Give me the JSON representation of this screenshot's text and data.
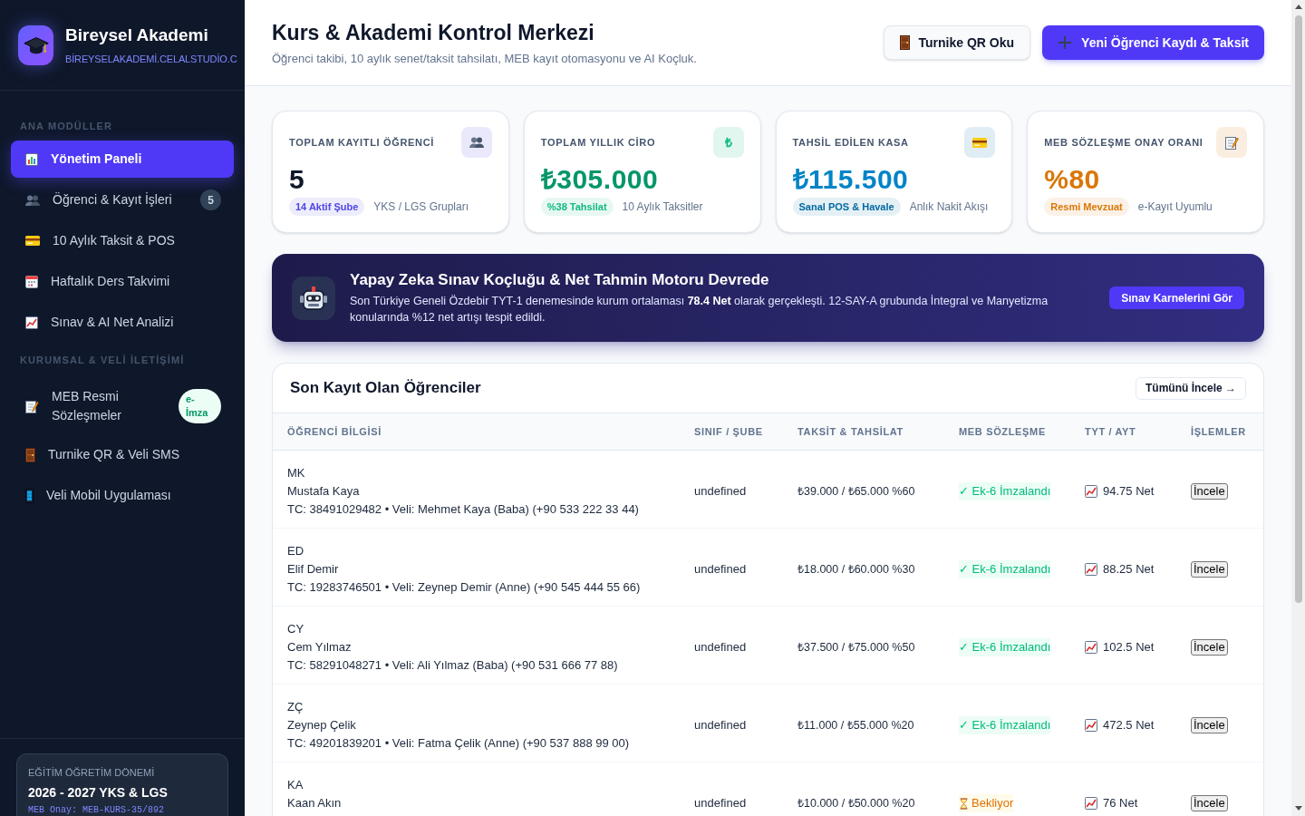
{
  "sidebar": {
    "brand": {
      "name": "Bireysel Akademi",
      "domain": "BİREYSELAKADEMİ.CELALSTUDİO.C"
    },
    "sections": [
      {
        "title": "ANA MODÜLLER",
        "items": [
          {
            "label": "Yönetim Paneli",
            "selected": true
          },
          {
            "label": "Öğrenci & Kayıt İşleri",
            "selected": false,
            "badge": {
              "kind": "count",
              "text": "5"
            }
          },
          {
            "label": "10 Aylık Taksit & POS",
            "selected": false
          },
          {
            "label": "Haftalık Ders Takvimi",
            "selected": false
          },
          {
            "label": "Sınav & AI Net Analizi",
            "selected": false
          }
        ]
      },
      {
        "title": "KURUMSAL & VELİ İLETİŞİMİ",
        "items": [
          {
            "label": "MEB Resmi Sözleşmeler",
            "selected": false,
            "badge": {
              "kind": "tag",
              "text": "e-İmza"
            }
          },
          {
            "label": "Turnike QR & Veli SMS",
            "selected": false
          },
          {
            "label": "Veli Mobil Uygulaması",
            "selected": false
          }
        ]
      }
    ],
    "term_card": {
      "label": "EĞİTİM ÖĞRETİM DÖNEMİ",
      "value": "2026 - 2027 YKS & LGS",
      "code": "MEB Onay: MEB-KURS-35/892"
    }
  },
  "header": {
    "title": "Kurs & Akademi Kontrol Merkezi",
    "subtitle": "Öğrenci takibi, 10 aylık senet/taksit tahsilatı, MEB kayıt otomasyonu ve AI Koçluk.",
    "buttons": [
      {
        "label": "Turnike QR Oku",
        "kind": "secondary"
      },
      {
        "label": "Yeni Öğrenci Kaydı & Taksit",
        "kind": "primary"
      }
    ]
  },
  "stats": [
    {
      "label": "TOPLAM KAYITLI ÖĞRENCİ",
      "value": "5",
      "color": "#0f172a",
      "badge": {
        "text": "14 Aktif Şube",
        "color": "#4f46e5"
      },
      "note": "YKS / LGS Grupları"
    },
    {
      "label": "TOPLAM YILLIK CİRO",
      "icon_glyph": "₺",
      "value": "₺305.000",
      "color": "#059669",
      "badge": {
        "text": "%38 Tahsilat",
        "color": "#10b981"
      },
      "note": "10 Aylık Taksitler"
    },
    {
      "label": "TAHSİL EDİLEN KASA",
      "value": "₺115.500",
      "color": "#0284c7",
      "badge": {
        "text": "Sanal POS & Havale",
        "color": "#0369a1"
      },
      "note": "Anlık Nakit Akışı"
    },
    {
      "label": "MEB SÖZLEŞME ONAY ORANI",
      "value": "%80",
      "color": "#d97706",
      "badge": {
        "text": "Resmi Mevzuat",
        "color": "#d97706"
      },
      "note": "e-Kayıt Uyumlu"
    }
  ],
  "banner": {
    "title": "Yapay Zeka Sınav Koçluğu & Net Tahmin Motoru Devrede",
    "text": "Son Türkiye Geneli Özdebir TYT-1 denemesinde kurum ortalaması **78.4 Net** olarak gerçekleşti. 12-SAY-A grubunda İntegral ve Manyetizma konularında %12 net artışı tespit edildi.",
    "button": "Sınav Karnelerini Gör"
  },
  "students_table": {
    "title": "Son Kayıt Olan Öğrenciler",
    "view_all": "Tümünü İncele →",
    "columns": [
      "ÖĞRENCİ BİLGİSİ",
      "SINIF / ŞUBE",
      "TAKSİT & TAHSİLAT",
      "MEB SÖZLEŞME",
      "TYT / AYT",
      "İŞLEMLER"
    ],
    "rows": [
      {
        "initials": "MK",
        "name": "Mustafa Kaya",
        "details": "TC: 38491029482 • Veli: Mehmet Kaya (Baba) (+90 533 222 33 44)",
        "group": "undefined",
        "payment": "₺39.000 / ₺65.000 %60",
        "contract": {
          "kind": "signed",
          "label": "✓ Ek-6 İmzalandı"
        },
        "score": "94.75 Net",
        "action": "İncele"
      },
      {
        "initials": "ED",
        "name": "Elif Demir",
        "details": "TC: 19283746501 • Veli: Zeynep Demir (Anne) (+90 545 444 55 66)",
        "group": "undefined",
        "payment": "₺18.000 / ₺60.000 %30",
        "contract": {
          "kind": "signed",
          "label": "✓ Ek-6 İmzalandı"
        },
        "score": "88.25 Net",
        "action": "İncele"
      },
      {
        "initials": "CY",
        "name": "Cem Yılmaz",
        "details": "TC: 58291048271 • Veli: Ali Yılmaz (Baba) (+90 531 666 77 88)",
        "group": "undefined",
        "payment": "₺37.500 / ₺75.000 %50",
        "contract": {
          "kind": "signed",
          "label": "✓ Ek-6 İmzalandı"
        },
        "score": "102.5 Net",
        "action": "İncele"
      },
      {
        "initials": "ZÇ",
        "name": "Zeynep Çelik",
        "details": "TC: 49201839201 • Veli: Fatma Çelik (Anne) (+90 537 888 99 00)",
        "group": "undefined",
        "payment": "₺11.000 / ₺55.000 %20",
        "contract": {
          "kind": "signed",
          "label": "✓ Ek-6 İmzalandı"
        },
        "score": "472.5 Net",
        "action": "İncele"
      },
      {
        "initials": "KA",
        "name": "Kaan Akın",
        "group": "undefined",
        "payment": "₺10.000 / ₺50.000 %20",
        "contract": {
          "kind": "pending",
          "label": "Bekliyor"
        },
        "score": "76 Net",
        "action": "İncele"
      }
    ]
  }
}
